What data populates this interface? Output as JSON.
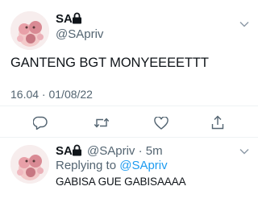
{
  "main_tweet": {
    "display_name": "SA",
    "handle": "@SApriv",
    "text": "GANTENG BGT MONYEEEETTT",
    "timestamp": "16.04 · 01/08/22",
    "protected_icon": "lock-icon",
    "menu_icon": "chevron-down-icon",
    "actions": [
      "reply-icon",
      "retweet-icon",
      "like-icon",
      "share-icon"
    ]
  },
  "reply_tweet": {
    "display_name": "SA",
    "handle_time": "@SApriv · 5m",
    "replying_prefix": "Replying to ",
    "replying_handle": "@SApriv",
    "text": "GABISA GUE GABISAAAA",
    "protected_icon": "lock-icon",
    "menu_icon": "chevron-down-icon"
  },
  "colors": {
    "text_primary": "#0f1419",
    "text_secondary": "#536471",
    "accent": "#1d9bf0",
    "divider": "#eff3f4"
  }
}
